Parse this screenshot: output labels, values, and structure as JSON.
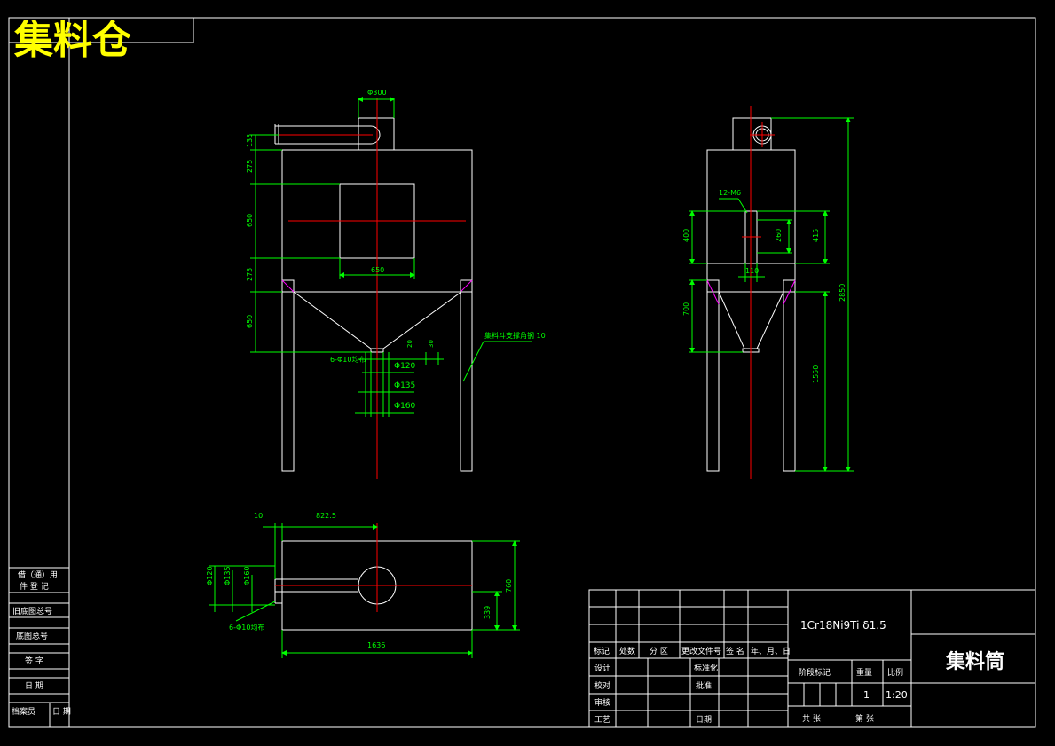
{
  "sheet": {
    "top_title": "集料仓",
    "drawing_title": "集料筒",
    "material": "1Cr18Ni9Ti  δ1.5",
    "quantity": "1",
    "scale": "1:20",
    "company": "集料仓"
  },
  "front_view": {
    "top_pipe_dia": "Φ300",
    "dim_top": "135",
    "dim_upper": "275",
    "dim_middle": "650",
    "dim_lower": "275",
    "dim_hopper": "650",
    "window_width": "650",
    "hole_note": "6-Φ10均布",
    "dia_1": "Φ120",
    "dia_2": "Φ135",
    "dia_3": "Φ160",
    "small_1": "20",
    "small_2": "30",
    "support_note": "集料斗支撑角钢 10"
  },
  "side_view": {
    "bolt_note": "12-M6",
    "dim_400": "400",
    "dim_260": "260",
    "dim_415": "415",
    "dim_110": "110",
    "dim_700": "700",
    "dim_2850": "2850",
    "dim_1550": "1550"
  },
  "top_view": {
    "dim_10": "10",
    "dim_822": "822.5",
    "dia_a": "Φ120",
    "dia_b": "Φ135",
    "dia_c": "Φ160",
    "hole_note": "6-Φ10均布",
    "dim_760": "760",
    "dim_339": "339",
    "dim_1636": "1636"
  },
  "left_strip": {
    "rows": [
      "借（通）用",
      "件 登 记",
      "旧底图总号",
      "底图总号",
      "签  字",
      "日  期",
      "档案员",
      "日 期"
    ]
  },
  "title_block": {
    "h_mark": "标记",
    "h_count": "处数",
    "h_zone": "分 区",
    "h_docno": "更改文件号",
    "h_sign": "签 名",
    "h_date": "年、月、日",
    "r_design": "设计",
    "r_check": "校对",
    "r_review": "审核",
    "r_process": "工艺",
    "r_standard": "标准化",
    "r_approve": "批准",
    "r_date": "日期",
    "stage_mark": "阶段标记",
    "weight": "重量",
    "ratio": "比例",
    "sheets_total": "共    张",
    "sheet_no": "第    张"
  },
  "colors": {
    "background": "#000000",
    "outline": "#ffffff",
    "center_line": "#ff0000",
    "dimension": "#00ff00",
    "weld": "#ff00ff",
    "title": "#ffff00"
  }
}
